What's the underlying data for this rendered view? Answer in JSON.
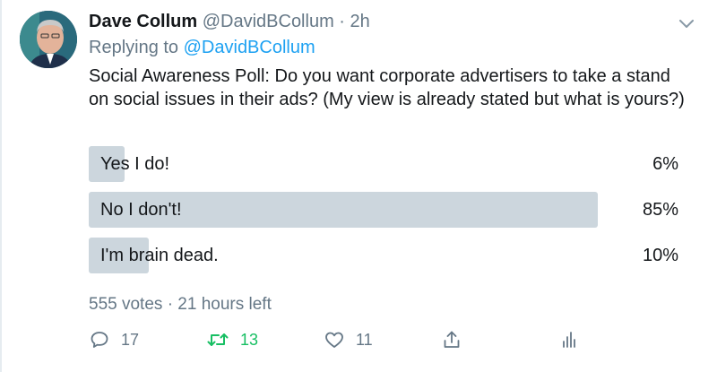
{
  "tweet": {
    "author_name": "Dave Collum",
    "handle": "@DavidBCollum",
    "separator": "·",
    "time": "2h",
    "replying_prefix": "Replying to",
    "replying_to": "@DavidBCollum",
    "text": "Social Awareness Poll: Do you want corporate advertisers to take a stand on social issues in their ads? (My view is already stated but what is yours?)"
  },
  "poll": {
    "options": [
      {
        "label": "Yes I do!",
        "percent_text": "6%",
        "percent": 6
      },
      {
        "label": "No I don't!",
        "percent_text": "85%",
        "percent": 85
      },
      {
        "label": "I'm brain dead.",
        "percent_text": "10%",
        "percent": 10
      }
    ],
    "votes": "555 votes",
    "separator": "·",
    "time_left": "21 hours left"
  },
  "actions": {
    "replies": "17",
    "retweets": "13",
    "likes": "11"
  },
  "colors": {
    "text": "#14171a",
    "muted": "#657786",
    "link": "#1da1f2",
    "retweet_green": "#17bf63",
    "poll_bar": "#ccd6dd"
  },
  "icons": [
    "chevron-down-icon",
    "reply-icon",
    "retweet-icon",
    "like-icon",
    "share-icon",
    "analytics-icon"
  ]
}
